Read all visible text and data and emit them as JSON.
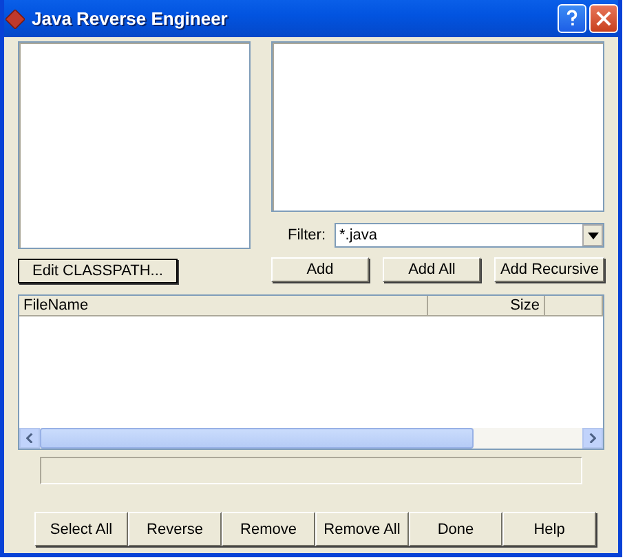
{
  "window": {
    "title": "Java Reverse Engineer"
  },
  "classpath_button": "Edit CLASSPATH...",
  "filter": {
    "label": "Filter:",
    "value": "*.java"
  },
  "add_buttons": [
    "Add",
    "Add All",
    "Add Recursive"
  ],
  "table": {
    "columns": [
      "FileName",
      "Size"
    ]
  },
  "buttons": [
    "Select All",
    "Reverse",
    "Remove",
    "Remove All",
    "Done",
    "Help"
  ]
}
